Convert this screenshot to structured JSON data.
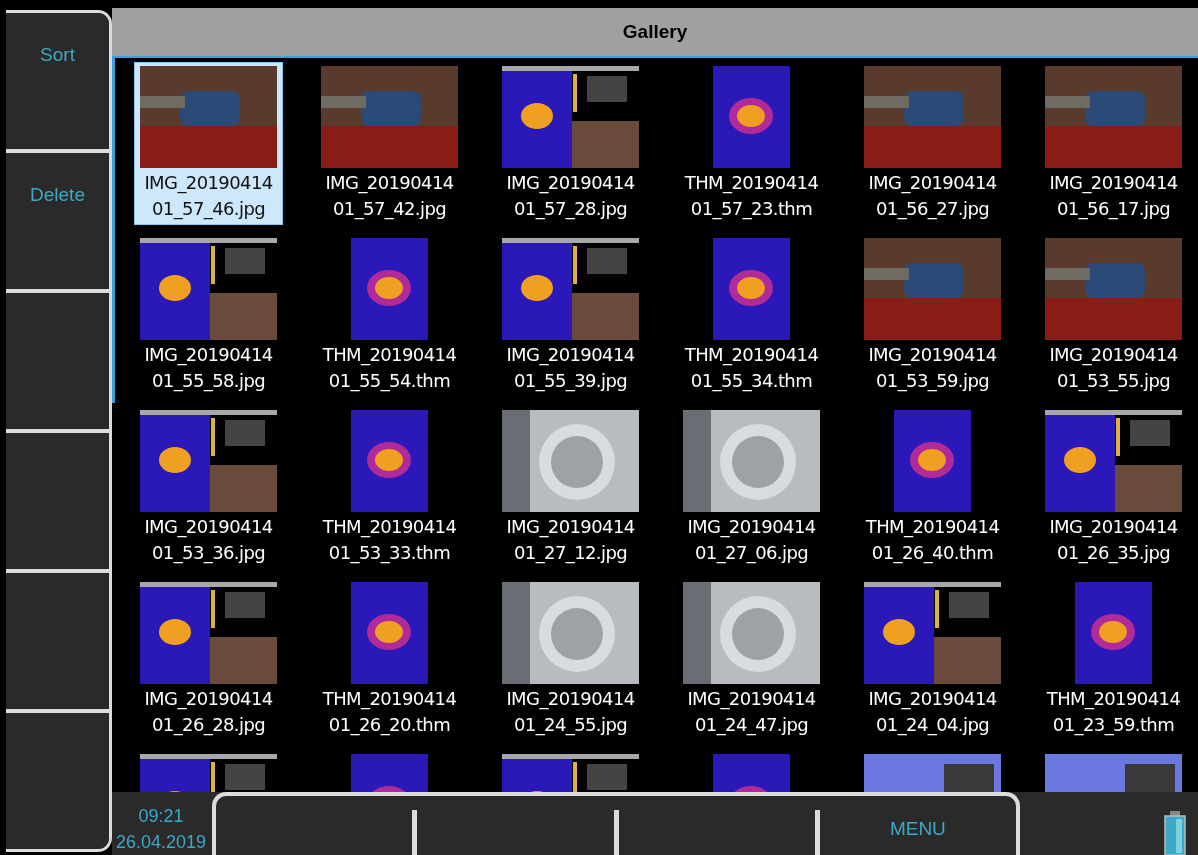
{
  "side_buttons": [
    "Sort",
    "Delete"
  ],
  "header": {
    "title": "Gallery"
  },
  "files": [
    {
      "caption": [
        "IMG_20190414",
        "01_57_46.jpg"
      ],
      "kind": "photo_pump",
      "selected": true
    },
    {
      "caption": [
        "IMG_20190414",
        "01_57_42.jpg"
      ],
      "kind": "photo_pump",
      "selected": false
    },
    {
      "caption": [
        "IMG_20190414",
        "01_57_28.jpg"
      ],
      "kind": "report",
      "selected": false
    },
    {
      "caption": [
        "THM_20190414",
        "01_57_23.thm"
      ],
      "kind": "thermal",
      "selected": false
    },
    {
      "caption": [
        "IMG_20190414",
        "01_56_27.jpg"
      ],
      "kind": "photo_pump",
      "selected": false
    },
    {
      "caption": [
        "IMG_20190414",
        "01_56_17.jpg"
      ],
      "kind": "photo_pump",
      "selected": false
    },
    {
      "caption": [
        "IMG_20190414",
        "01_55_58.jpg"
      ],
      "kind": "report",
      "selected": false
    },
    {
      "caption": [
        "THM_20190414",
        "01_55_54.thm"
      ],
      "kind": "thermal",
      "selected": false
    },
    {
      "caption": [
        "IMG_20190414",
        "01_55_39.jpg"
      ],
      "kind": "report",
      "selected": false
    },
    {
      "caption": [
        "THM_20190414",
        "01_55_34.thm"
      ],
      "kind": "thermal",
      "selected": false
    },
    {
      "caption": [
        "IMG_20190414",
        "01_53_59.jpg"
      ],
      "kind": "photo_pump",
      "selected": false
    },
    {
      "caption": [
        "IMG_20190414",
        "01_53_55.jpg"
      ],
      "kind": "photo_pump",
      "selected": false
    },
    {
      "caption": [
        "IMG_20190414",
        "01_53_36.jpg"
      ],
      "kind": "report",
      "selected": false
    },
    {
      "caption": [
        "THM_20190414",
        "01_53_33.thm"
      ],
      "kind": "thermal",
      "selected": false
    },
    {
      "caption": [
        "IMG_20190414",
        "01_27_12.jpg"
      ],
      "kind": "photo_motor",
      "selected": false
    },
    {
      "caption": [
        "IMG_20190414",
        "01_27_06.jpg"
      ],
      "kind": "photo_motor",
      "selected": false
    },
    {
      "caption": [
        "THM_20190414",
        "01_26_40.thm"
      ],
      "kind": "thermal",
      "selected": false
    },
    {
      "caption": [
        "IMG_20190414",
        "01_26_35.jpg"
      ],
      "kind": "report",
      "selected": false
    },
    {
      "caption": [
        "IMG_20190414",
        "01_26_28.jpg"
      ],
      "kind": "report",
      "selected": false
    },
    {
      "caption": [
        "THM_20190414",
        "01_26_20.thm"
      ],
      "kind": "thermal",
      "selected": false
    },
    {
      "caption": [
        "IMG_20190414",
        "01_24_55.jpg"
      ],
      "kind": "photo_motor",
      "selected": false
    },
    {
      "caption": [
        "IMG_20190414",
        "01_24_47.jpg"
      ],
      "kind": "photo_motor",
      "selected": false
    },
    {
      "caption": [
        "IMG_20190414",
        "01_24_04.jpg"
      ],
      "kind": "report",
      "selected": false
    },
    {
      "caption": [
        "THM_20190414",
        "01_23_59.thm"
      ],
      "kind": "thermal",
      "selected": false
    },
    {
      "kind": "report",
      "selected": false
    },
    {
      "kind": "thermal",
      "selected": false
    },
    {
      "kind": "report",
      "selected": false
    },
    {
      "kind": "thermal",
      "selected": false
    },
    {
      "kind": "photo_blue",
      "selected": false
    },
    {
      "kind": "photo_blue",
      "selected": false
    }
  ],
  "status": {
    "time": "09:21",
    "date": "26.04.2019"
  },
  "bottom_menu_label": "MENU"
}
